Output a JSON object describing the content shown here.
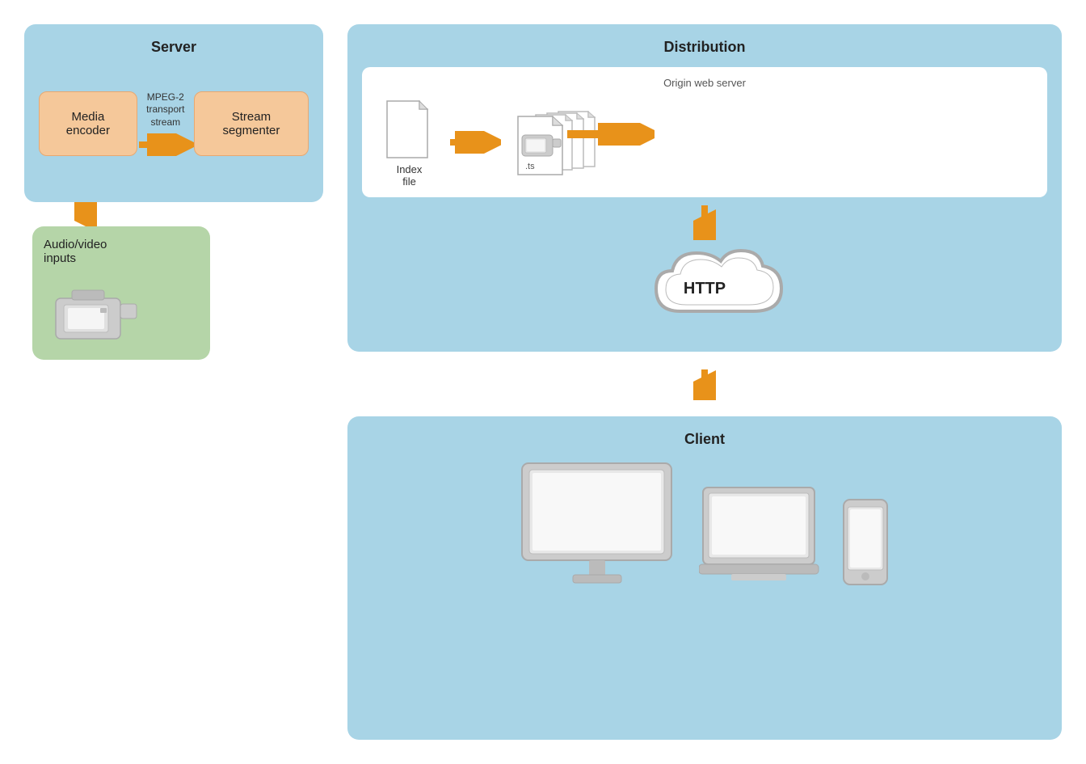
{
  "server": {
    "title": "Server",
    "media_encoder": "Media encoder",
    "stream_segmenter": "Stream segmenter",
    "mpeg_label": "MPEG-2\ntransport\nstream"
  },
  "audio_video": {
    "label": "Audio/video\ninputs"
  },
  "distribution": {
    "title": "Distribution",
    "origin_label": "Origin web server",
    "index_file": "Index\nfile",
    "ts_label": ".ts",
    "http_label": "HTTP"
  },
  "client": {
    "title": "Client"
  }
}
